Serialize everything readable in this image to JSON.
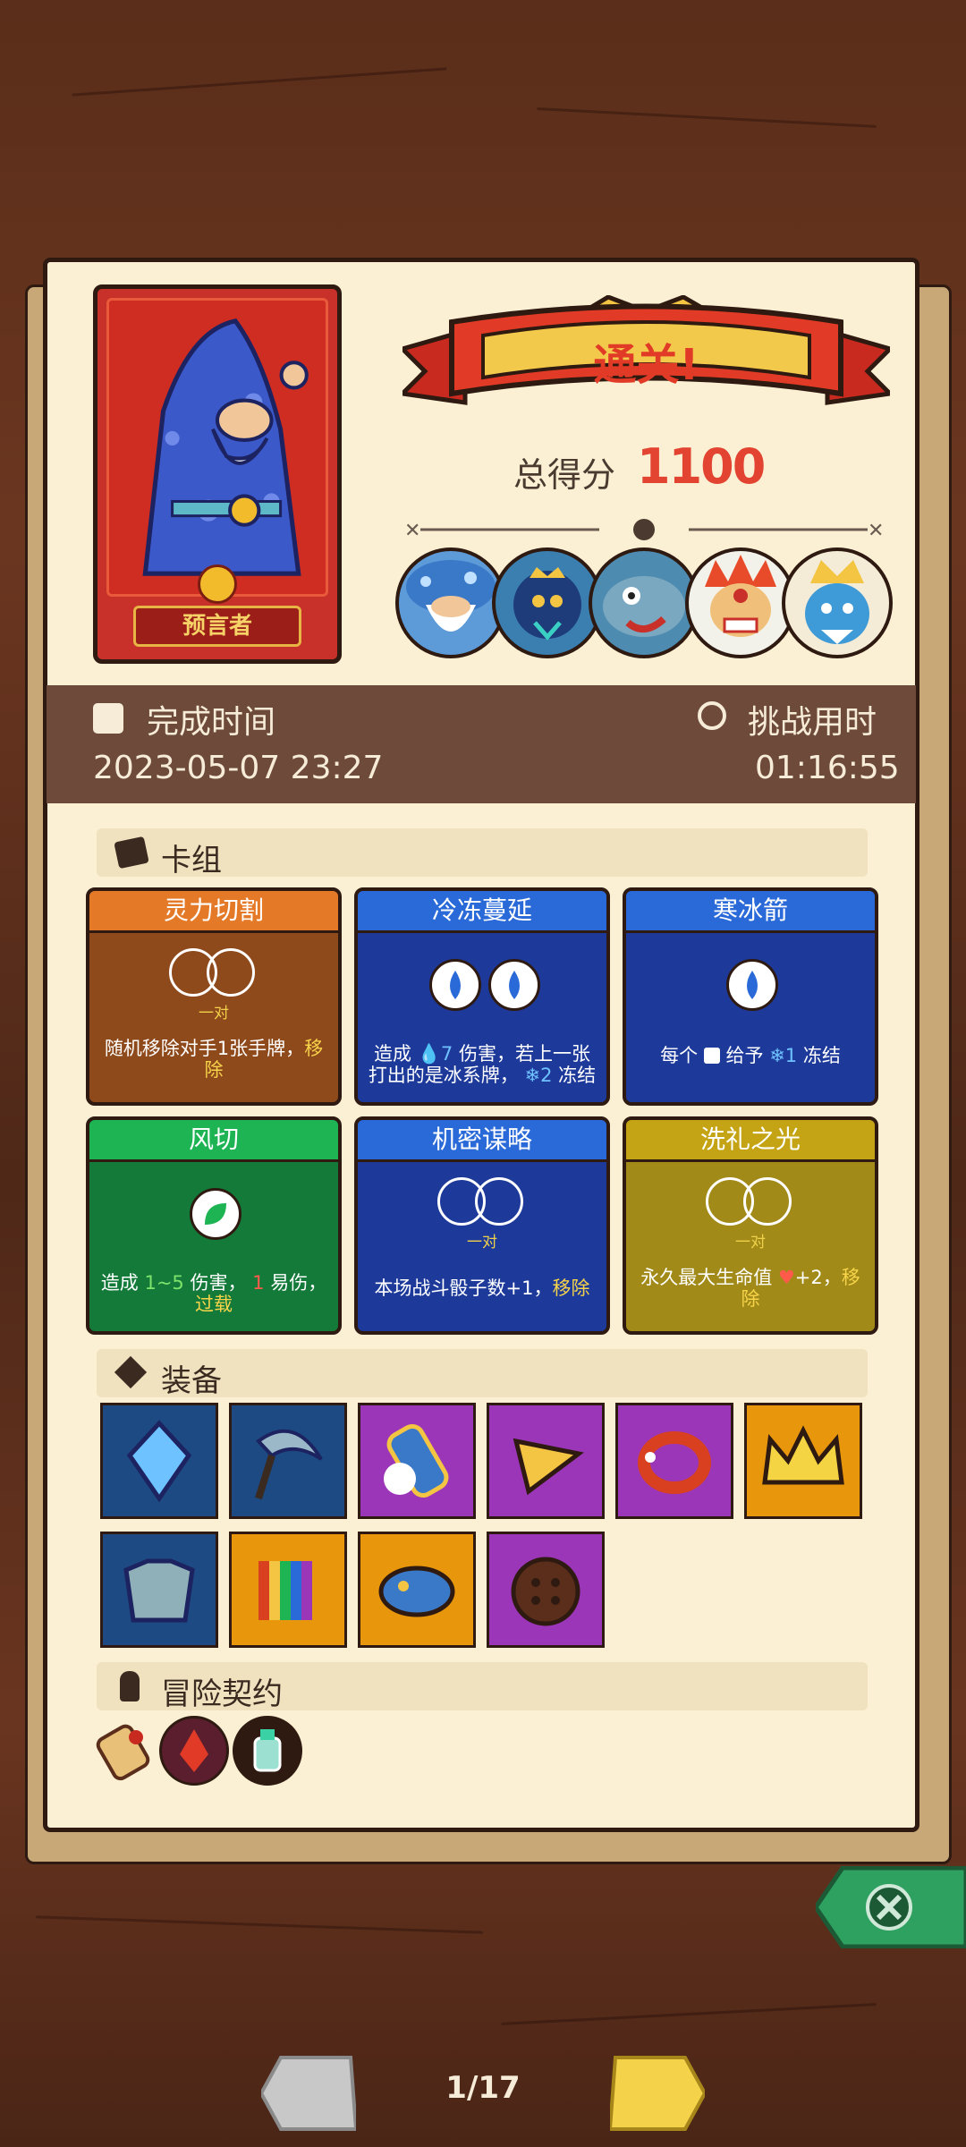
{
  "hero": {
    "label": "预言者"
  },
  "result": {
    "banner": "通关!",
    "score_label": "总得分",
    "score_value": "1100"
  },
  "bosses": [
    "mushroom-sage-icon",
    "crowned-spider-icon",
    "fish-monster-icon",
    "fire-demon-icon",
    "ice-king-icon"
  ],
  "times": {
    "complete_label": "完成时间",
    "complete_value": "2023-05-07 23:27",
    "challenge_label": "挑战用时",
    "challenge_value": "01:16:55"
  },
  "deck": {
    "title": "卡组",
    "cards": [
      {
        "name": "灵力切割",
        "duo": "一对",
        "text": "随机移除对手1张手牌，",
        "tag": "移除"
      },
      {
        "name": "冷冻蔓延",
        "text_a": "造成",
        "val_a": "7",
        "text_b": "伤害，若上一张打出的是冰系牌，",
        "val_b": "2",
        "text_c": "冻结"
      },
      {
        "name": "寒冰箭",
        "text_a": "每个",
        "text_b": "给予",
        "val_b": "1",
        "text_c": "冻结"
      },
      {
        "name": "风切",
        "text_a": "造成",
        "val_a": "1~5",
        "text_b": "伤害，",
        "val_b": "1",
        "text_c": "易伤，",
        "tag": "过载"
      },
      {
        "name": "机密谋略",
        "duo": "一对",
        "text": "本场战斗骰子数+1，",
        "tag": "移除"
      },
      {
        "name": "洗礼之光",
        "duo": "一对",
        "text": "永久最大生命值",
        "val": "+2，",
        "tag": "移除"
      }
    ]
  },
  "equipment": {
    "title": "装备",
    "items": [
      "blue-gem-icon",
      "scythe-icon",
      "cloud-scroll-icon",
      "cheese-wedge-icon",
      "spiked-bracelet-icon",
      "gold-crown-icon",
      "scale-armor-icon",
      "rainbow-books-icon",
      "paint-palette-icon",
      "button-icon"
    ]
  },
  "contract": {
    "title": "冒险契约",
    "items": [
      "scroll-icon",
      "red-demon-seal-icon",
      "potion-bottle-icon"
    ]
  },
  "pager": {
    "text": "1/17"
  },
  "colors": {
    "panel": "#fbf0d4",
    "orange_card": "#8f4a1c",
    "blue_card": "#1d3a9a",
    "green_card": "#137a3a",
    "gold_card": "#a28a18"
  }
}
